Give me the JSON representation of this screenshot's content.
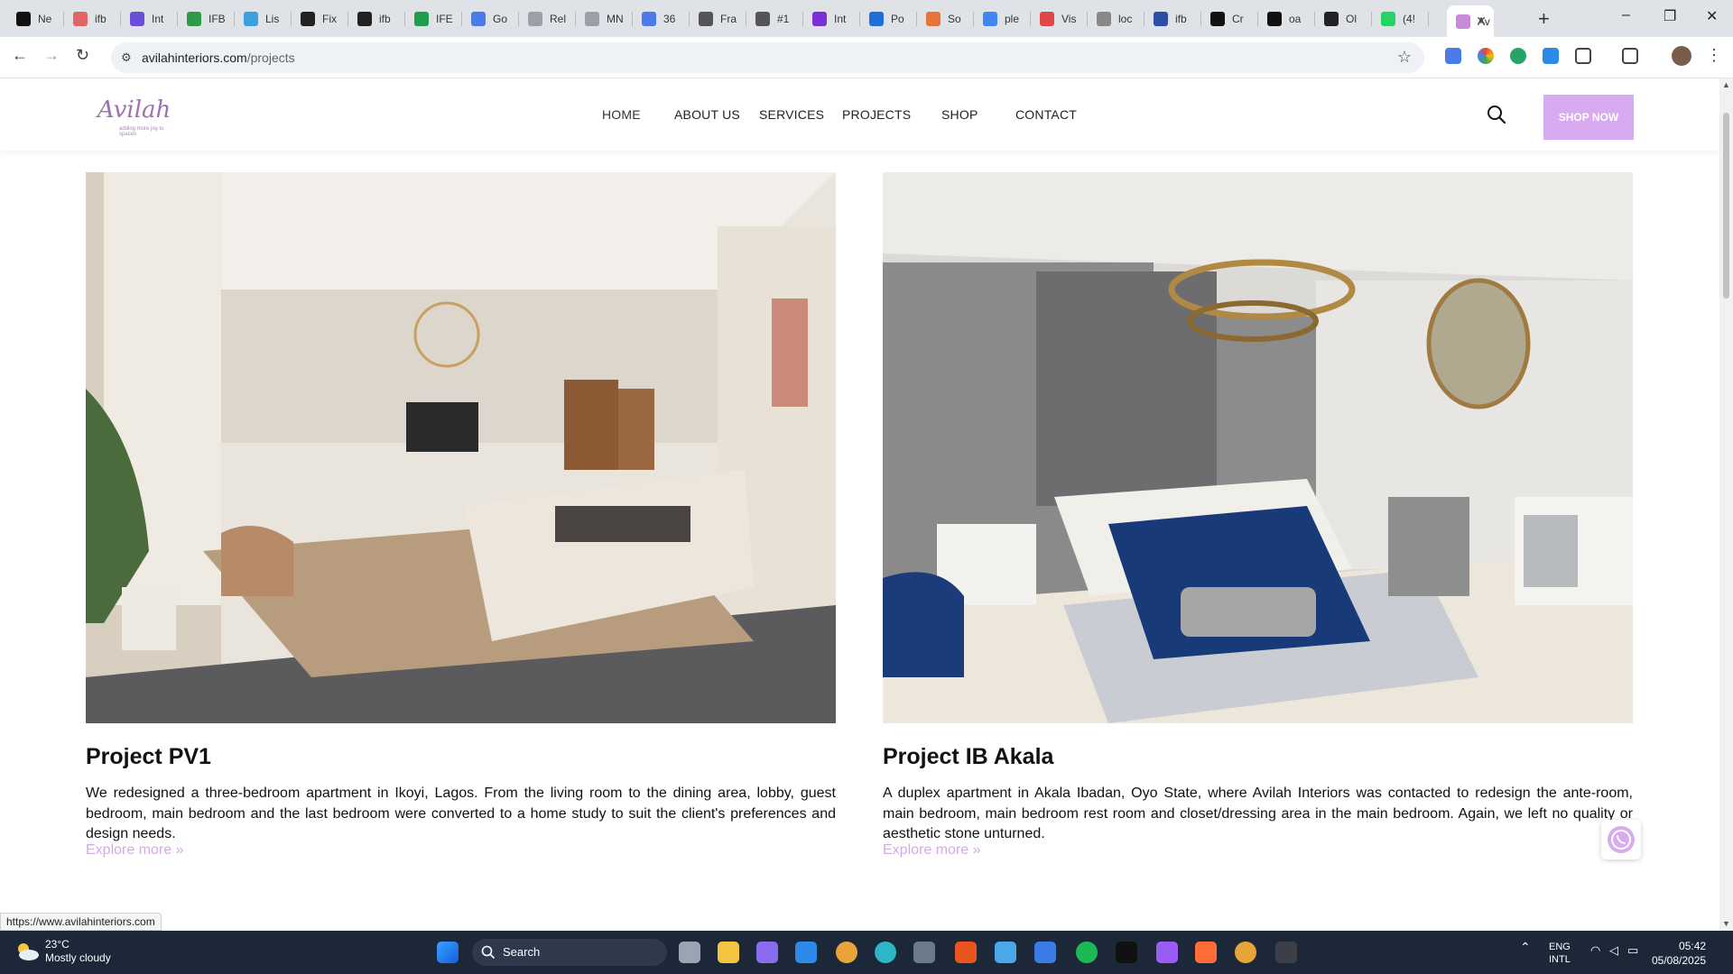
{
  "browser": {
    "tabs": [
      {
        "label": "Ne",
        "color": "#111111"
      },
      {
        "label": "ifb",
        "color": "#e06666"
      },
      {
        "label": "Int",
        "color": "#6b4fd8"
      },
      {
        "label": "IFB",
        "color": "#2f9a4a"
      },
      {
        "label": "Lis",
        "color": "#3aa0e0"
      },
      {
        "label": "Fix",
        "color": "#222222"
      },
      {
        "label": "ifb",
        "color": "#222222"
      },
      {
        "label": "IFE",
        "color": "#1e9e4b"
      },
      {
        "label": "Go",
        "color": "#4a7be8"
      },
      {
        "label": "Rel",
        "color": "#9aa0a6"
      },
      {
        "label": "MN",
        "color": "#9aa0a6"
      },
      {
        "label": "36",
        "color": "#4a7be8"
      },
      {
        "label": "Fra",
        "color": "#555555"
      },
      {
        "label": "#1",
        "color": "#555555"
      },
      {
        "label": "Int",
        "color": "#7b2fd8"
      },
      {
        "label": "Po",
        "color": "#1f6fd8"
      },
      {
        "label": "So",
        "color": "#e8743a"
      },
      {
        "label": "ple",
        "color": "#4285f4"
      },
      {
        "label": "Vis",
        "color": "#e04848"
      },
      {
        "label": "loc",
        "color": "#888888"
      },
      {
        "label": "ifb",
        "color": "#2b4fa8"
      },
      {
        "label": "Cr",
        "color": "#111111"
      },
      {
        "label": "oa",
        "color": "#111111"
      },
      {
        "label": "Ol",
        "color": "#222222"
      },
      {
        "label": "(4!",
        "color": "#25d366"
      },
      {
        "label": "Av",
        "color": "#c98ad8"
      }
    ],
    "active_tab_close": "✕",
    "new_tab": "+",
    "window_controls": {
      "minimize": "–",
      "maximize": "❐",
      "close": "✕"
    },
    "nav": {
      "back": "←",
      "forward": "→",
      "reload": "↻"
    },
    "url_host": "avilahinteriors.com",
    "url_path": "/projects",
    "bookmark_icon": "☆",
    "status_url": "https://www.avilahinteriors.com"
  },
  "site": {
    "logo_text": "Avilah",
    "logo_tagline": "adding more joy to spaces",
    "nav": [
      "HOME",
      "ABOUT US",
      "SERVICES",
      "PROJECTS",
      "SHOP",
      "CONTACT"
    ],
    "cta": "SHOP NOW",
    "accent_color": "#d8aaf0",
    "link_color": "#d5a8e8"
  },
  "projects": [
    {
      "title": "Project PV1",
      "description": "We redesigned a three-bedroom apartment in Ikoyi, Lagos. From the living room to the dining area, lobby, guest bedroom, main bedroom and the last bedroom were converted to a home study to suit the client's preferences and design needs.",
      "link": "Explore more »"
    },
    {
      "title": "Project IB Akala",
      "description": "A duplex apartment in Akala Ibadan, Oyo State, where Avilah Interiors was contacted to redesign the ante-room, main bedroom, main bedroom rest room and closet/dressing area in the main bedroom. Again, we left no quality or aesthetic stone unturned.",
      "link": "Explore more »"
    }
  ],
  "taskbar": {
    "weather_temp": "23°C",
    "weather_desc": "Mostly cloudy",
    "search_label": "Search",
    "lang_line1": "ENG",
    "lang_line2": "INTL",
    "time": "05:42",
    "date": "05/08/2025"
  }
}
